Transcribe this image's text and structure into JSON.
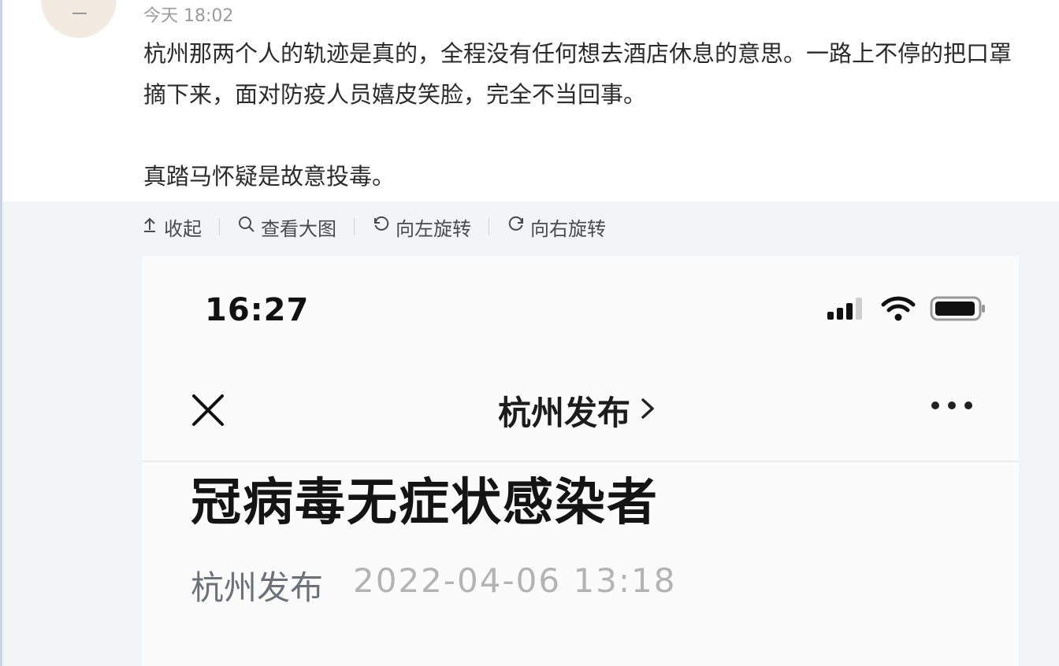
{
  "post": {
    "timestamp": "今天 18:02",
    "paragraphs": [
      "杭州那两个人的轨迹是真的，全程没有任何想去酒店休息的意思。一路上不停的把口罩摘下来，面对防疫人员嬉皮笑脸，完全不当回事。",
      "真踏马怀疑是故意投毒。"
    ]
  },
  "toolbar": {
    "collapse": {
      "label": "收起",
      "icon": "collapse-up-icon"
    },
    "view_large": {
      "label": "查看大图",
      "icon": "search-icon"
    },
    "rotate_left": {
      "label": "向左旋转",
      "icon": "rotate-left-icon"
    },
    "rotate_right": {
      "label": "向右旋转",
      "icon": "rotate-right-icon"
    }
  },
  "phone": {
    "status_time": "16:27",
    "status_icons": [
      "signal-icon",
      "wifi-icon",
      "battery-icon"
    ],
    "nav": {
      "close_icon": "close-icon",
      "title": "杭州发布",
      "title_chevron": "chevron-right-icon",
      "more_icon": "more-icon"
    },
    "article": {
      "title": "冠病毒无症状感染者",
      "author": "杭州发布",
      "date": "2022-04-06 13:18"
    }
  },
  "colors": {
    "text": "#2b2b2b",
    "muted": "#9b9b9b",
    "panel": "#f3f4f6"
  }
}
